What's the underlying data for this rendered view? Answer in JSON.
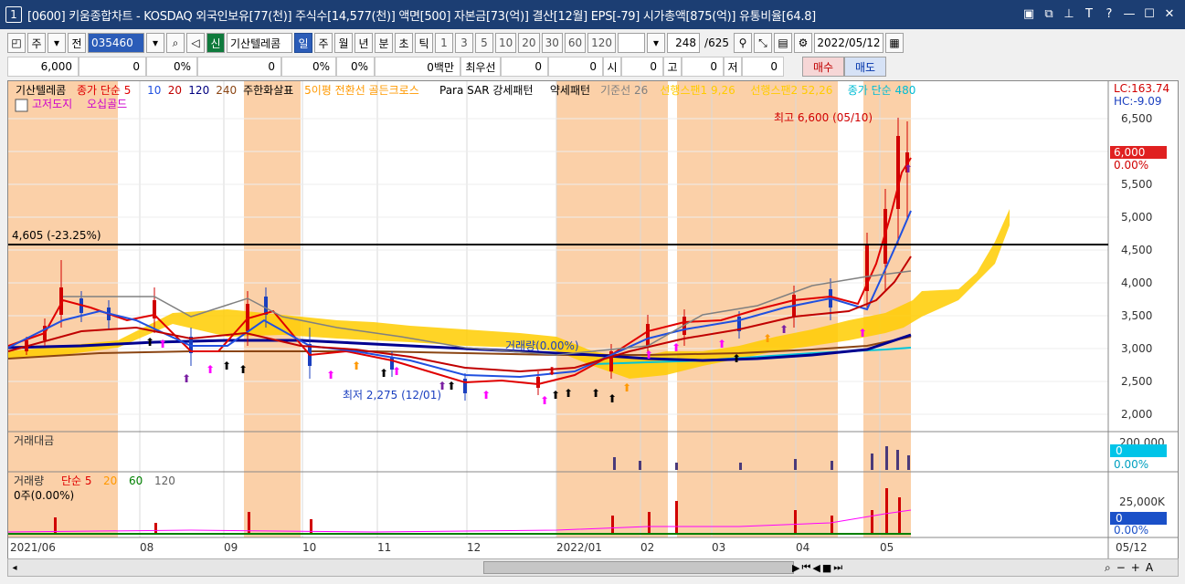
{
  "window": {
    "number": "1",
    "title": "[0600] 키움종합차트 - KOSDAQ 외국인보유[77(천)] 주식수[14,577(천)] 액면[500] 자본금[73(억)] 결산[12월] EPS[-79] 시가총액[875(억)] 유통비율[64.8]",
    "btn_min": "—",
    "btn_max": "☐",
    "btn_close": "✕",
    "btn_t": "T",
    "btn_help": "?"
  },
  "toolbar": {
    "period": "주",
    "prev": "전",
    "code": "035460",
    "name_badge": "신",
    "stock_name": "기산텔레콤",
    "periods": [
      "일",
      "주",
      "월",
      "년",
      "분",
      "초",
      "틱"
    ],
    "intervals": [
      "1",
      "3",
      "5",
      "10",
      "20",
      "30",
      "60",
      "120"
    ],
    "count": "248",
    "total": "/625",
    "date": "2022/05/12"
  },
  "quote": {
    "price": "6,000",
    "change": "0",
    "change_pct": "0%",
    "volume": "0",
    "vol_pct": "0%",
    "vol_pct2": "0%",
    "amount": "0백만",
    "pref_label": "최우선",
    "bid": "0",
    "ask": "0",
    "open_label": "시",
    "open": "0",
    "high_label": "고",
    "high": "0",
    "low_label": "저",
    "low": "0",
    "buy": "매수",
    "sell": "매도"
  },
  "legend": {
    "line1": [
      {
        "text": "기산텔레콤",
        "color": "#000000"
      },
      {
        "text": "종가 단순 5",
        "color": "#e00000"
      },
      {
        "text": "10",
        "color": "#2050e0"
      },
      {
        "text": "20",
        "color": "#c00000"
      },
      {
        "text": "120",
        "color": "#000080"
      },
      {
        "text": "240",
        "color": "#8b4513"
      },
      {
        "text": "주한화살표",
        "color": "#000000"
      },
      {
        "text": "5이평 전환선 골든크로스",
        "color": "#ff9900"
      },
      {
        "text": "Para SAR 강세패턴",
        "color": "#000000"
      },
      {
        "text": "약세패턴",
        "color": "#000000"
      },
      {
        "text": "기준선 26",
        "color": "#808080"
      },
      {
        "text": "선행스팬1 9,26",
        "color": "#ffcc00"
      },
      {
        "text": "선행스팬2 52,26",
        "color": "#ffcc00"
      },
      {
        "text": "종가 단순 480",
        "color": "#00bcd4"
      }
    ],
    "line2": [
      {
        "text": "고저도지",
        "color": "#cc00cc"
      },
      {
        "text": "오십골드",
        "color": "#cc00cc"
      }
    ]
  },
  "price_panel": {
    "lc": "LC:163.74",
    "hc": "HC:-9.09",
    "y_ticks": [
      "6,500",
      "6,000",
      "5,500",
      "5,000",
      "4,500",
      "4,000",
      "3,500",
      "3,000",
      "2,500",
      "2,000"
    ],
    "current_price": "6,000",
    "current_pct": "0.00%",
    "hline_label": "4,605 (-23.25%)",
    "high_annot": "최고 6,600 (05/10)",
    "low_annot": "최저 2,275 (12/01)",
    "mid_annot": "거래량(0.00%)"
  },
  "amount_panel": {
    "title": "거래대금",
    "tick": "200,000",
    "val": "0",
    "pct": "0.00%"
  },
  "volume_panel": {
    "title": "거래량",
    "ma_labels": [
      {
        "text": "단순 5",
        "color": "#e00000"
      },
      {
        "text": "20",
        "color": "#ff9900"
      },
      {
        "text": "60",
        "color": "#008000"
      },
      {
        "text": "120",
        "color": "#606060"
      }
    ],
    "sub": "0주(0.00%)",
    "tick": "25,000K",
    "val": "0",
    "pct": "0.00%"
  },
  "x_axis": {
    "labels": [
      "2021/06",
      "08",
      "09",
      "10",
      "11",
      "12",
      "2022/01",
      "02",
      "03",
      "04",
      "05"
    ],
    "right_label": "05/12"
  },
  "colors": {
    "up": "#d00000",
    "down": "#1a3fbf",
    "highlight": "#fbd0a8",
    "cloud": "#ffcc00"
  }
}
